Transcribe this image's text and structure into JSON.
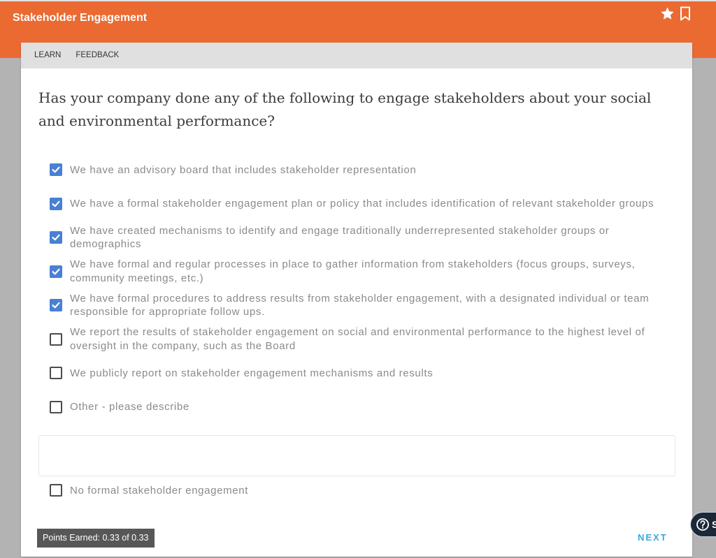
{
  "header": {
    "title": "Stakeholder Engagement",
    "favorite_icon": "star-icon",
    "bookmark_icon": "bookmark-icon"
  },
  "tabs": [
    {
      "label": "LEARN"
    },
    {
      "label": "FEEDBACK"
    }
  ],
  "question": "Has your company done any of the following to engage stakeholders about your social and environmental performance?",
  "options": [
    {
      "label": "We have an advisory board that includes stakeholder representation",
      "checked": true
    },
    {
      "label": "We have a formal stakeholder engagement plan or policy that includes identification of relevant stakeholder groups",
      "checked": true
    },
    {
      "label": "We have created mechanisms to identify and engage traditionally underrepresented stakeholder groups or demographics",
      "checked": true
    },
    {
      "label": "We have formal and regular processes in place to gather information from stakeholders (focus groups, surveys, community meetings, etc.)",
      "checked": true
    },
    {
      "label": "We have formal procedures to address results from stakeholder engagement, with a designated individual or team responsible for appropriate follow ups.",
      "checked": true
    },
    {
      "label": "We report the results of stakeholder engagement on social and environmental performance to the highest level of oversight in the company, such as the Board",
      "checked": false
    },
    {
      "label": "We publicly report on stakeholder engagement mechanisms and results",
      "checked": false
    },
    {
      "label": "Other - please describe",
      "checked": false
    }
  ],
  "other_description": {
    "value": ""
  },
  "none_option": {
    "label": "No formal stakeholder engagement",
    "checked": false
  },
  "footer": {
    "points_earned": "Points Earned: 0.33 of 0.33",
    "next_label": "NEXT"
  },
  "help_widget": {
    "icon": "question-circle-icon",
    "label": "S"
  },
  "colors": {
    "header_orange": "#ea6a32",
    "checkbox_blue": "#4a80d4",
    "next_blue": "#3aa6e0",
    "points_badge": "#575757"
  }
}
